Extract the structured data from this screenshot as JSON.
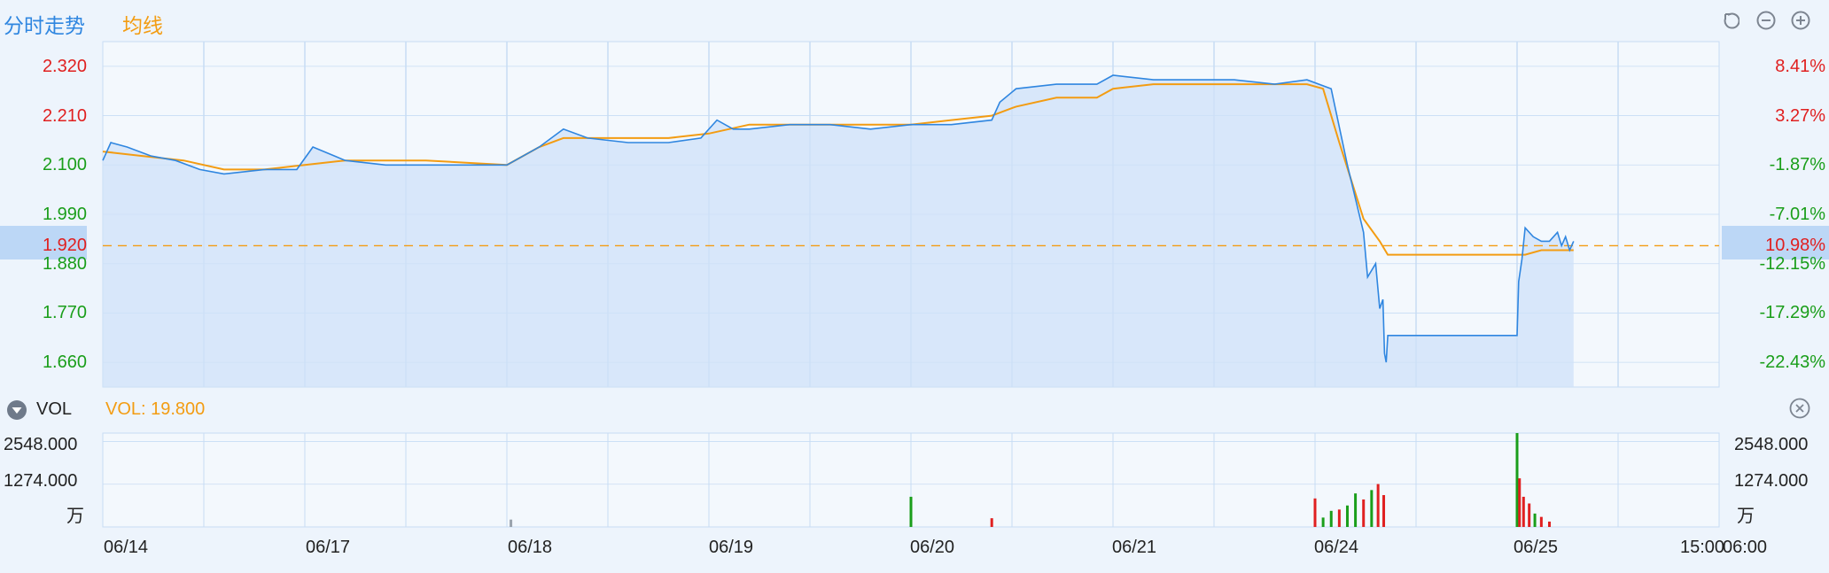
{
  "tabs": {
    "timeshare": "分时走势",
    "average": "均线"
  },
  "colors": {
    "price": "#2f86e0",
    "avg": "#f39c12",
    "up": "#e02020",
    "down": "#1a9e1a",
    "grid": "#c7dcf4",
    "fill": "#cfe1f8"
  },
  "chart_data": {
    "type": "line",
    "y_left_ticks": [
      "2.320",
      "2.210",
      "2.100",
      "1.990",
      "1.880",
      "1.770",
      "1.660"
    ],
    "y_right_ticks": [
      "8.41%",
      "3.27%",
      "-1.87%",
      "-7.01%",
      "-12.15%",
      "-17.29%",
      "-22.43%"
    ],
    "ylim": [
      1.605,
      2.375
    ],
    "current": {
      "price": "1.920",
      "pct": "10.98%"
    },
    "x_labels": [
      "06/14",
      "06/17",
      "06/18",
      "06/19",
      "06/20",
      "06/21",
      "06/24",
      "06/25",
      "15:00",
      "06:00"
    ],
    "x_range": [
      0,
      20
    ],
    "day_starts": [
      0,
      2.5,
      5,
      7.5,
      10,
      12.5,
      15,
      17.5
    ],
    "price_series": {
      "name": "",
      "x": [
        0,
        0.1,
        0.3,
        0.6,
        0.9,
        1.2,
        1.5,
        2.0,
        2.4,
        2.6,
        3.0,
        3.5,
        4.0,
        4.5,
        5.0,
        5.4,
        5.7,
        6.0,
        6.5,
        7.0,
        7.4,
        7.6,
        7.8,
        8.0,
        8.5,
        9.0,
        9.5,
        10.0,
        10.5,
        11.0,
        11.1,
        11.3,
        11.8,
        12.3,
        12.5,
        13.0,
        13.5,
        14.0,
        14.5,
        14.9,
        15.2,
        15.4,
        15.6,
        15.65,
        15.75,
        15.8,
        15.84,
        15.86,
        15.88,
        15.9,
        17.5,
        17.52,
        17.56,
        17.6,
        17.7,
        17.8,
        17.9,
        18.0,
        18.05,
        18.1,
        18.15,
        18.2
      ],
      "values": [
        2.11,
        2.15,
        2.14,
        2.12,
        2.11,
        2.09,
        2.08,
        2.09,
        2.09,
        2.14,
        2.11,
        2.1,
        2.1,
        2.1,
        2.1,
        2.14,
        2.18,
        2.16,
        2.15,
        2.15,
        2.16,
        2.2,
        2.18,
        2.18,
        2.19,
        2.19,
        2.18,
        2.19,
        2.19,
        2.2,
        2.24,
        2.27,
        2.28,
        2.28,
        2.3,
        2.29,
        2.29,
        2.29,
        2.28,
        2.29,
        2.27,
        2.1,
        1.95,
        1.85,
        1.88,
        1.78,
        1.8,
        1.68,
        1.66,
        1.72,
        1.72,
        1.84,
        1.89,
        1.96,
        1.94,
        1.93,
        1.93,
        1.95,
        1.92,
        1.94,
        1.91,
        1.93
      ]
    },
    "avg_series": {
      "name": "",
      "x": [
        0,
        0.5,
        1.0,
        1.5,
        2.0,
        2.5,
        3.0,
        4.0,
        5.0,
        5.4,
        5.7,
        6.0,
        6.5,
        7.0,
        7.5,
        8.0,
        8.5,
        9.0,
        9.5,
        10.0,
        10.5,
        11.0,
        11.3,
        11.8,
        12.3,
        12.5,
        13.0,
        14.0,
        14.9,
        15.1,
        15.3,
        15.6,
        15.8,
        15.9,
        17.5,
        17.6,
        17.8,
        18.2
      ],
      "values": [
        2.13,
        2.12,
        2.11,
        2.09,
        2.09,
        2.1,
        2.11,
        2.11,
        2.1,
        2.14,
        2.16,
        2.16,
        2.16,
        2.16,
        2.17,
        2.19,
        2.19,
        2.19,
        2.19,
        2.19,
        2.2,
        2.21,
        2.23,
        2.25,
        2.25,
        2.27,
        2.28,
        2.28,
        2.28,
        2.27,
        2.15,
        1.98,
        1.93,
        1.9,
        1.9,
        1.9,
        1.91,
        1.91
      ]
    }
  },
  "volume": {
    "label": "VOL",
    "value_label": "VOL: 19.800",
    "ticks": [
      "2548.000",
      "1274.000"
    ],
    "unit": "万",
    "ylim": [
      0,
      2800
    ],
    "spikes": [
      {
        "x": 5.05,
        "v": 220,
        "dir": "neutral"
      },
      {
        "x": 10.0,
        "v": 900,
        "dir": "down"
      },
      {
        "x": 11.0,
        "v": 260,
        "dir": "up"
      },
      {
        "x": 15.0,
        "v": 850,
        "dir": "up"
      },
      {
        "x": 15.1,
        "v": 280,
        "dir": "down"
      },
      {
        "x": 15.2,
        "v": 480,
        "dir": "down"
      },
      {
        "x": 15.3,
        "v": 520,
        "dir": "up"
      },
      {
        "x": 15.4,
        "v": 640,
        "dir": "down"
      },
      {
        "x": 15.5,
        "v": 1000,
        "dir": "down"
      },
      {
        "x": 15.6,
        "v": 820,
        "dir": "up"
      },
      {
        "x": 15.7,
        "v": 1100,
        "dir": "down"
      },
      {
        "x": 15.78,
        "v": 1280,
        "dir": "up"
      },
      {
        "x": 15.85,
        "v": 950,
        "dir": "up"
      },
      {
        "x": 17.5,
        "v": 2800,
        "dir": "down"
      },
      {
        "x": 17.53,
        "v": 1450,
        "dir": "up"
      },
      {
        "x": 17.58,
        "v": 900,
        "dir": "up"
      },
      {
        "x": 17.65,
        "v": 700,
        "dir": "up"
      },
      {
        "x": 17.72,
        "v": 400,
        "dir": "down"
      },
      {
        "x": 17.8,
        "v": 300,
        "dir": "up"
      },
      {
        "x": 17.9,
        "v": 160,
        "dir": "up"
      }
    ]
  }
}
